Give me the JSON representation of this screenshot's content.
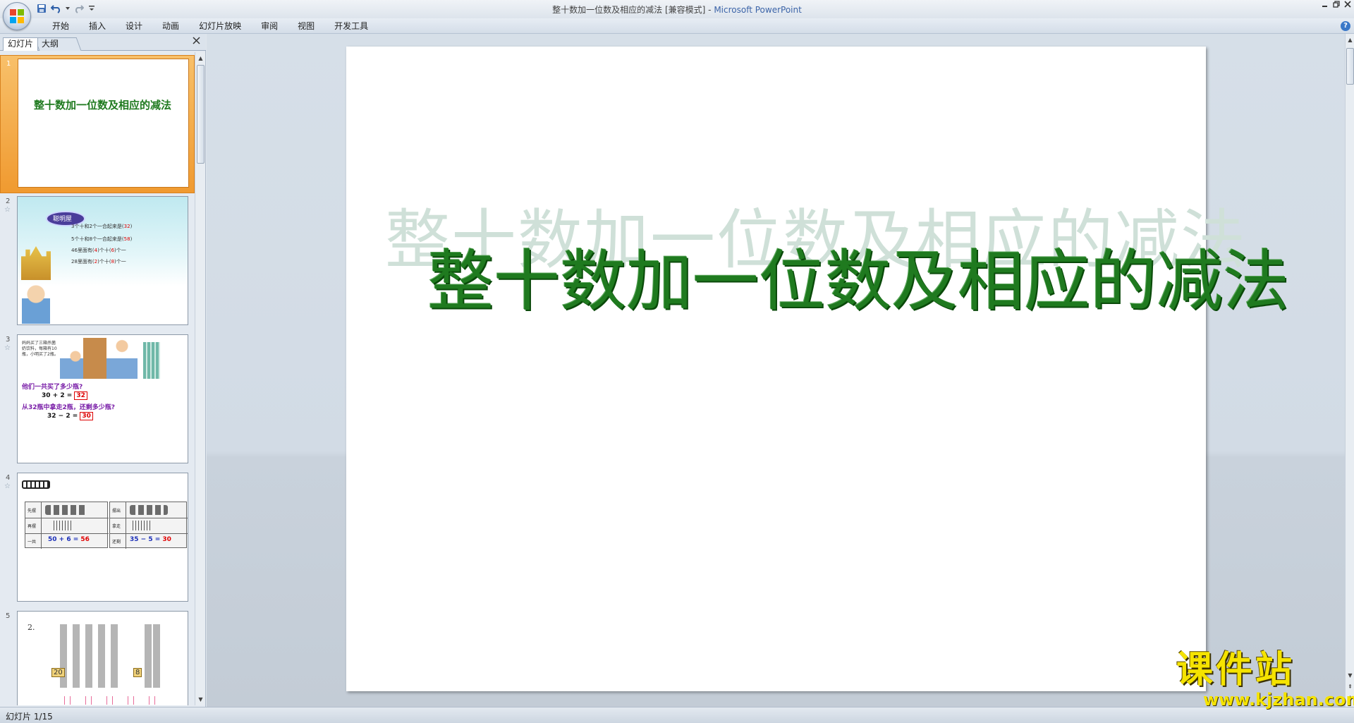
{
  "window": {
    "title": "整十数加一位数及相应的减法 [兼容模式]",
    "title_sep": " - ",
    "app_name": "Microsoft PowerPoint"
  },
  "ribbon": {
    "tabs": [
      "开始",
      "插入",
      "设计",
      "动画",
      "幻灯片放映",
      "审阅",
      "视图",
      "开发工具"
    ]
  },
  "pane": {
    "tab_slides": "幻灯片",
    "tab_outline": "大纲"
  },
  "thumbnails": [
    {
      "num": "1",
      "title": "整十数加一位数及相应的减法"
    },
    {
      "num": "2",
      "bubble": "聪明屋",
      "lines": [
        {
          "pre": "3个十和2个一合起来是(",
          "ans": "32",
          "post": ")"
        },
        {
          "pre": "5个十和8个一合起来是(",
          "ans": "58",
          "post": ")"
        },
        {
          "pre": "46里面有(",
          "ans": "4",
          "mid": ")个十(",
          "ans2": "6",
          "post": ")个一"
        },
        {
          "pre": "28里面有(",
          "ans": "2",
          "mid": ")个十(",
          "ans2": "8",
          "post": ")个一"
        }
      ]
    },
    {
      "num": "3",
      "story": [
        "妈妈买了三箱杀菌",
        "奶饮料，每箱有10",
        "瓶，小明买了2瓶。"
      ],
      "q1": "他们一共买了多少瓶?",
      "eq1": "30 + 2 =",
      "a1": "32",
      "q2": "从32瓶中拿走2瓶，还剩多少瓶?",
      "eq2": "32 − 2 =",
      "a2": "30"
    },
    {
      "num": "4",
      "left_labels": [
        "先摆",
        "再摆",
        "一共"
      ],
      "right_labels": [
        "摆出",
        "拿走",
        "还剩"
      ],
      "eq_left": "50 + 6 =",
      "ans_left": "56",
      "eq_right": "35 − 5 =",
      "ans_right": "30"
    },
    {
      "num": "5",
      "label": "2.",
      "tag1": "20",
      "tag2": "8"
    }
  ],
  "slide": {
    "title": "整十数加一位数及相应的减法"
  },
  "status": {
    "text": "幻灯片 1/15"
  },
  "watermark": {
    "brand": "课件站",
    "url": "www.kjzhan.com"
  }
}
